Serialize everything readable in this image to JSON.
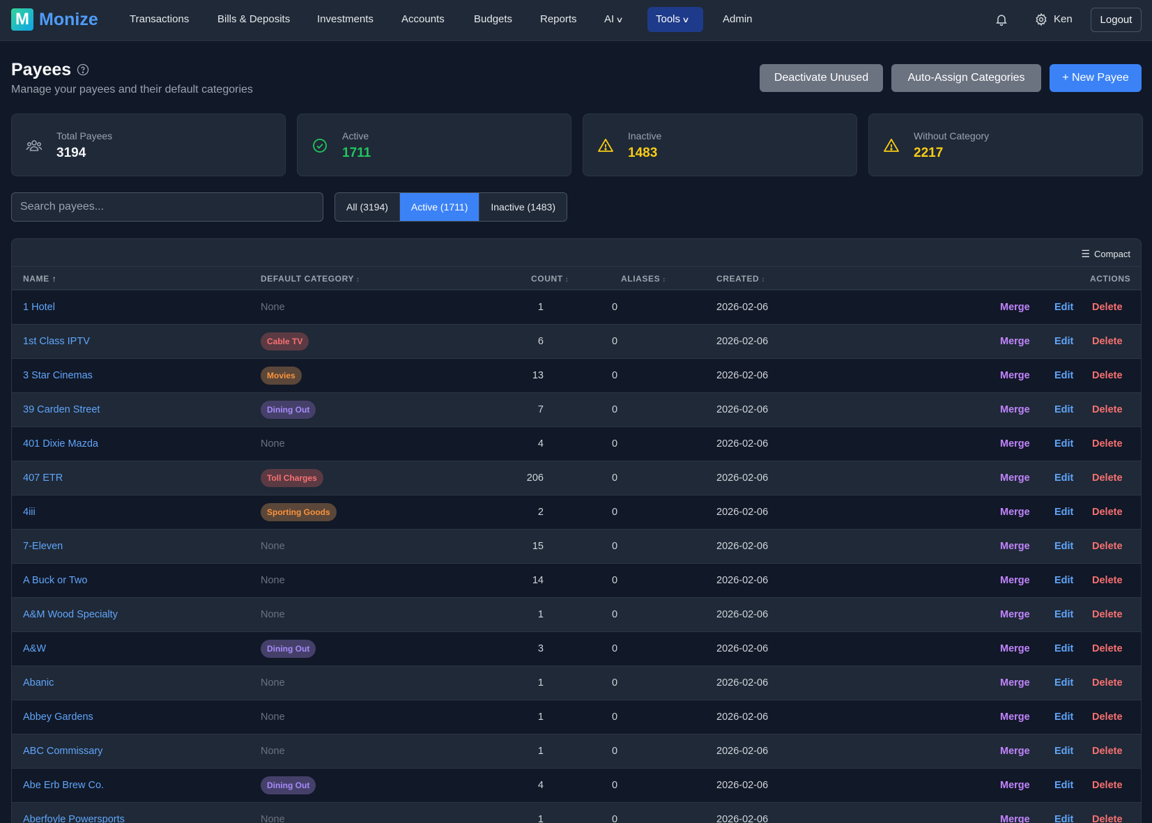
{
  "app": {
    "logo_letter": "M",
    "name": "Monize"
  },
  "nav": {
    "items": [
      "Transactions",
      "Bills & Deposits",
      "Investments",
      "Accounts",
      "Budgets",
      "Reports"
    ],
    "ai_label": "AI",
    "tools_label": "Tools",
    "admin_label": "Admin",
    "user_name": "Ken",
    "logout_label": "Logout"
  },
  "header": {
    "title": "Payees",
    "subtitle": "Manage your payees and their default categories",
    "deactivate_label": "Deactivate Unused",
    "auto_assign_label": "Auto-Assign Categories",
    "new_label": "+ New Payee"
  },
  "stats": [
    {
      "label": "Total Payees",
      "value": "3194",
      "icon": "users-icon",
      "color": "#f3f4f6"
    },
    {
      "label": "Active",
      "value": "1711",
      "icon": "check-circle-icon",
      "color": "#22c55e"
    },
    {
      "label": "Inactive",
      "value": "1483",
      "icon": "warning-icon",
      "color": "#facc15"
    },
    {
      "label": "Without Category",
      "value": "2217",
      "icon": "warning-icon",
      "color": "#facc15"
    }
  ],
  "search": {
    "placeholder": "Search payees...",
    "value": ""
  },
  "filters": [
    {
      "label": "All (3194)",
      "active": false
    },
    {
      "label": "Active (1711)",
      "active": true
    },
    {
      "label": "Inactive (1483)",
      "active": false
    }
  ],
  "table": {
    "compact_label": "Compact",
    "columns": {
      "name": "NAME",
      "category": "DEFAULT CATEGORY",
      "count": "COUNT",
      "aliases": "ALIASES",
      "created": "CREATED",
      "actions": "ACTIONS"
    },
    "action_labels": {
      "merge": "Merge",
      "edit": "Edit",
      "delete": "Delete"
    },
    "rows": [
      {
        "name": "1 Hotel",
        "category": "None",
        "count": "1",
        "aliases": "0",
        "created": "2026-02-06"
      },
      {
        "name": "1st Class IPTV",
        "category": "Cable TV",
        "badge_bg": "#5b3a43",
        "badge_fg": "#f87171",
        "count": "6",
        "aliases": "0",
        "created": "2026-02-06"
      },
      {
        "name": "3 Star Cinemas",
        "category": "Movies",
        "badge_bg": "#5a4739",
        "badge_fg": "#fb923c",
        "count": "13",
        "aliases": "0",
        "created": "2026-02-06"
      },
      {
        "name": "39 Carden Street",
        "category": "Dining Out",
        "badge_bg": "#45406a",
        "badge_fg": "#a78bfa",
        "count": "7",
        "aliases": "0",
        "created": "2026-02-06"
      },
      {
        "name": "401 Dixie Mazda",
        "category": "None",
        "count": "4",
        "aliases": "0",
        "created": "2026-02-06"
      },
      {
        "name": "407 ETR",
        "category": "Toll Charges",
        "badge_bg": "#5b3a43",
        "badge_fg": "#f87171",
        "count": "206",
        "aliases": "0",
        "created": "2026-02-06"
      },
      {
        "name": "4iii",
        "category": "Sporting Goods",
        "badge_bg": "#5a4739",
        "badge_fg": "#fb923c",
        "count": "2",
        "aliases": "0",
        "created": "2026-02-06"
      },
      {
        "name": "7-Eleven",
        "category": "None",
        "count": "15",
        "aliases": "0",
        "created": "2026-02-06"
      },
      {
        "name": "A Buck or Two",
        "category": "None",
        "count": "14",
        "aliases": "0",
        "created": "2026-02-06"
      },
      {
        "name": "A&M Wood Specialty",
        "category": "None",
        "count": "1",
        "aliases": "0",
        "created": "2026-02-06"
      },
      {
        "name": "A&W",
        "category": "Dining Out",
        "badge_bg": "#45406a",
        "badge_fg": "#a78bfa",
        "count": "3",
        "aliases": "0",
        "created": "2026-02-06"
      },
      {
        "name": "Abanic",
        "category": "None",
        "count": "1",
        "aliases": "0",
        "created": "2026-02-06"
      },
      {
        "name": "Abbey Gardens",
        "category": "None",
        "count": "1",
        "aliases": "0",
        "created": "2026-02-06"
      },
      {
        "name": "ABC Commissary",
        "category": "None",
        "count": "1",
        "aliases": "0",
        "created": "2026-02-06"
      },
      {
        "name": "Abe Erb Brew Co.",
        "category": "Dining Out",
        "badge_bg": "#45406a",
        "badge_fg": "#a78bfa",
        "count": "4",
        "aliases": "0",
        "created": "2026-02-06"
      },
      {
        "name": "Aberfoyle Powersports",
        "category": "None",
        "count": "1",
        "aliases": "0",
        "created": "2026-02-06"
      }
    ]
  }
}
